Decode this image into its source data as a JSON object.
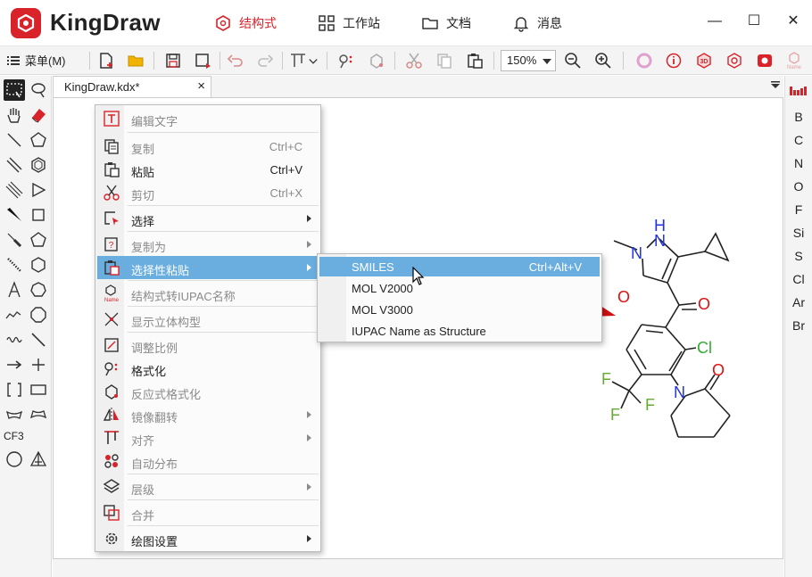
{
  "app": {
    "brand": "KingDraw",
    "brand_color": "#d8232a",
    "nav_tabs": [
      {
        "label": "结构式",
        "icon": "structure-icon",
        "active": true
      },
      {
        "label": "工作站",
        "icon": "workstation-icon",
        "active": false
      },
      {
        "label": "文档",
        "icon": "folder-icon",
        "active": false
      },
      {
        "label": "消息",
        "icon": "bell-icon",
        "active": false
      }
    ],
    "window_controls": {
      "minimize": "—",
      "maximize": "☐",
      "close": "✕"
    }
  },
  "toolbar": {
    "menu_label": "菜单(M)",
    "zoom_value": "150%"
  },
  "left_tools": {
    "cf3_label": "CF3"
  },
  "document_tab": {
    "title": "KingDraw.kdx*",
    "close": "×"
  },
  "element_bar": {
    "items": [
      "B",
      "C",
      "N",
      "O",
      "F",
      "Si",
      "S",
      "Cl",
      "Ar",
      "Br"
    ]
  },
  "context_menu": {
    "items": [
      {
        "label": "编辑文字",
        "shortcut": "",
        "icon": "text-edit-icon",
        "disabled": true,
        "submenu": false
      },
      {
        "label": "复制",
        "shortcut": "Ctrl+C",
        "icon": "copy-icon",
        "disabled": true,
        "submenu": false
      },
      {
        "label": "粘贴",
        "shortcut": "Ctrl+V",
        "icon": "paste-icon",
        "disabled": false,
        "submenu": false
      },
      {
        "label": "剪切",
        "shortcut": "Ctrl+X",
        "icon": "scissors-icon",
        "disabled": true,
        "submenu": false
      },
      {
        "label": "选择",
        "shortcut": "",
        "icon": "select-icon",
        "disabled": false,
        "submenu": true
      },
      {
        "label": "复制为",
        "shortcut": "",
        "icon": "copy-as-icon",
        "disabled": true,
        "submenu": true
      },
      {
        "label": "选择性粘贴",
        "shortcut": "",
        "icon": "paste-special-icon",
        "disabled": false,
        "submenu": true,
        "highlighted": true
      },
      {
        "label": "结构式转IUPAC名称",
        "shortcut": "",
        "icon": "structure-to-name-icon",
        "disabled": true,
        "submenu": false
      },
      {
        "label": "显示立体构型",
        "shortcut": "",
        "icon": "stereo-icon",
        "disabled": true,
        "submenu": false
      },
      {
        "label": "调整比例",
        "shortcut": "",
        "icon": "scale-icon",
        "disabled": true,
        "submenu": false
      },
      {
        "label": "格式化",
        "shortcut": "",
        "icon": "format-icon",
        "disabled": false,
        "submenu": false
      },
      {
        "label": "反应式格式化",
        "shortcut": "",
        "icon": "reaction-format-icon",
        "disabled": true,
        "submenu": false
      },
      {
        "label": "镜像翻转",
        "shortcut": "",
        "icon": "mirror-icon",
        "disabled": true,
        "submenu": true
      },
      {
        "label": "对齐",
        "shortcut": "",
        "icon": "align-icon",
        "disabled": true,
        "submenu": true
      },
      {
        "label": "自动分布",
        "shortcut": "",
        "icon": "distribute-icon",
        "disabled": true,
        "submenu": false
      },
      {
        "label": "层级",
        "shortcut": "",
        "icon": "layers-icon",
        "disabled": true,
        "submenu": true
      },
      {
        "label": "合并",
        "shortcut": "",
        "icon": "merge-icon",
        "disabled": true,
        "submenu": false
      },
      {
        "label": "绘图设置",
        "shortcut": "",
        "icon": "gear-icon",
        "disabled": false,
        "submenu": true
      }
    ]
  },
  "submenu": {
    "items": [
      {
        "label": "SMILES",
        "shortcut": "Ctrl+Alt+V",
        "highlighted": true
      },
      {
        "label": "MOL V2000",
        "shortcut": ""
      },
      {
        "label": "MOL V3000",
        "shortcut": ""
      },
      {
        "label": "IUPAC Name as Structure",
        "shortcut": ""
      }
    ]
  },
  "molecule": {
    "atoms": {
      "h": "H",
      "n": "N",
      "o": "O",
      "cl": "Cl",
      "f": "F"
    },
    "colors": {
      "nitrogen": "#2233dd",
      "oxygen": "#e01010",
      "chlorine": "#33aa33",
      "fluorine": "#66aa33",
      "arrow": "#d01010"
    }
  }
}
